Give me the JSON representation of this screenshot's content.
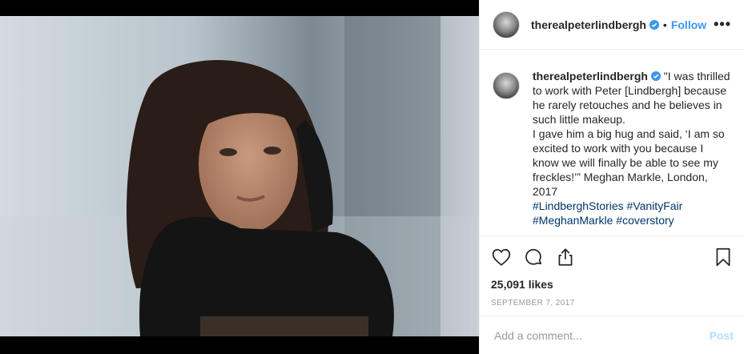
{
  "post": {
    "username": "therealpeterlindbergh",
    "follow_label": "Follow",
    "separator": "•",
    "more_label": "•••",
    "caption_username": "therealpeterlindbergh",
    "caption_body": " \"I was thrilled to work with Peter [Lindbergh] because he rarely retouches and he believes in such little makeup.",
    "caption_body2": "I gave him a big hug and said, ‘I am so excited to work with you because I know we will finally be able to see my freckles!’” Meghan Markle, London, 2017",
    "hashtags": [
      "#LindberghStories",
      "#VanityFair",
      "#MeghanMarkle",
      "#coverstory"
    ],
    "likes": "25,091 likes",
    "date": "SEPTEMBER 7, 2017"
  },
  "comment": {
    "placeholder": "Add a comment...",
    "post_label": "Post"
  },
  "icons": {
    "like": "heart-icon",
    "comment": "comment-icon",
    "share": "share-icon",
    "save": "bookmark-icon",
    "verified": "verified-badge-icon"
  },
  "colors": {
    "link": "#3897f0",
    "hashtag": "#003569",
    "post_disabled": "#b2dffc",
    "muted": "#999999"
  }
}
